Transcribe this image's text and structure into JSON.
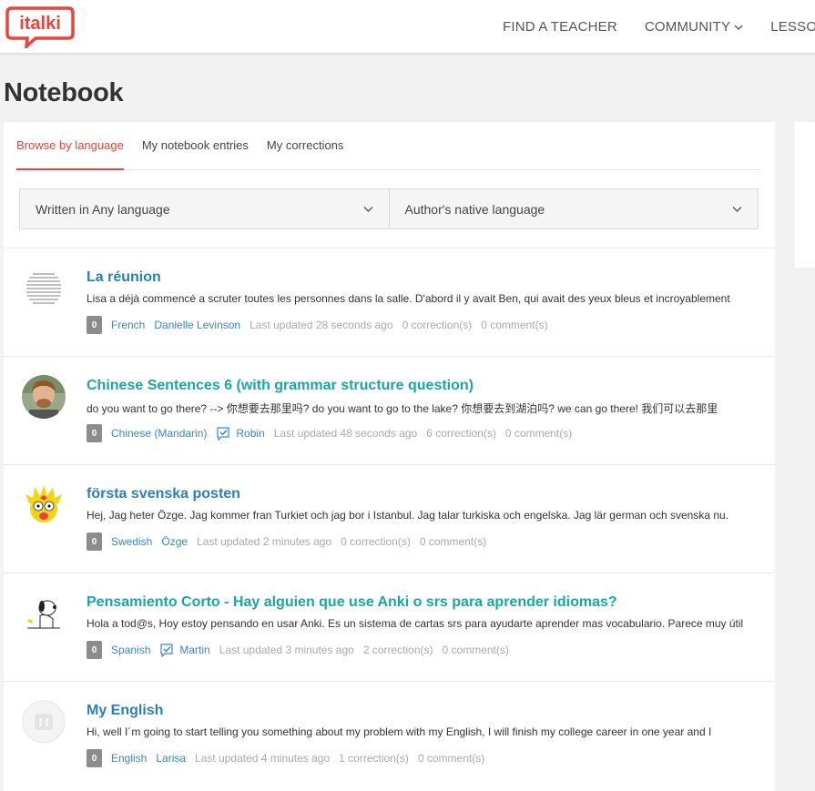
{
  "brand": {
    "logo_text": "italki",
    "color": "#e8453c"
  },
  "nav": {
    "items": [
      {
        "label": "FIND A TEACHER",
        "dropdown": false
      },
      {
        "label": "COMMUNITY",
        "dropdown": true
      },
      {
        "label": "LESSONS",
        "dropdown": false
      }
    ]
  },
  "page": {
    "title": "Notebook"
  },
  "tabs": [
    {
      "label": "Browse by language",
      "active": true
    },
    {
      "label": "My notebook entries",
      "active": false
    },
    {
      "label": "My corrections",
      "active": false
    }
  ],
  "filters": {
    "written_in": "Written in Any language",
    "native_language": "Author's native language"
  },
  "entries": [
    {
      "title": "La réunion",
      "title_color": "#2e7fb8",
      "excerpt": "Lisa a déjà commencé a scruter toutes les personnes dans la salle. D'abord il y avait Ben, qui avait des yeux bleus et incroyablement",
      "badge": "0",
      "language": "French",
      "verified": false,
      "author": "Danielle Levinson",
      "updated": "Last updated 28 seconds ago",
      "corrections": "0 correction(s)",
      "comments": "0 comment(s)",
      "avatar": "text-avatar"
    },
    {
      "title": "Chinese Sentences 6 (with grammar structure question)",
      "title_color": "#1aa6a6",
      "excerpt": "do you want to go there? --> 你想要去那里吗? do you want to go to the lake? 你想要去到湖泊吗? we can go there! 我们可以去那里",
      "badge": "0",
      "language": "Chinese (Mandarin)",
      "verified": true,
      "author": "Robin",
      "updated": "Last updated 48 seconds ago",
      "corrections": "6 correction(s)",
      "comments": "0 comment(s)",
      "avatar": "photo-avatar"
    },
    {
      "title": "första svenska posten",
      "title_color": "#2e7fb8",
      "excerpt": "Hej, Jag heter Özge. Jag kommer fran Turkiet och jag bor i Istanbul. Jag talar turkiska och engelska. Jag lär german och svenska nu.",
      "badge": "0",
      "language": "Swedish",
      "verified": false,
      "author": "Özge",
      "updated": "Last updated 2 minutes ago",
      "corrections": "0 correction(s)",
      "comments": "0 comment(s)",
      "avatar": "cartoon-avatar"
    },
    {
      "title": "Pensamiento Corto - Hay alguien que use Anki o srs para aprender idiomas?",
      "title_color": "#1aa6a6",
      "excerpt": "Hola a tod@s, Hoy estoy pensando en usar Anki. Es un sistema de cartas srs para ayudarte aprender mas vocabulario. Parece muy útil",
      "badge": "0",
      "language": "Spanish",
      "verified": true,
      "author": "Martin",
      "updated": "Last updated 3 minutes ago",
      "corrections": "2 correction(s)",
      "comments": "0 comment(s)",
      "avatar": "dog-avatar"
    },
    {
      "title": "My English",
      "title_color": "#2e7fb8",
      "excerpt": "Hi, well I´m going to start telling you something about my problem with my English, I will finish my college career in one year and I",
      "badge": "0",
      "language": "English",
      "verified": false,
      "author": "Larisa",
      "updated": "Last updated 4 minutes ago",
      "corrections": "1 correction(s)",
      "comments": "0 comment(s)",
      "avatar": "default-avatar"
    }
  ]
}
